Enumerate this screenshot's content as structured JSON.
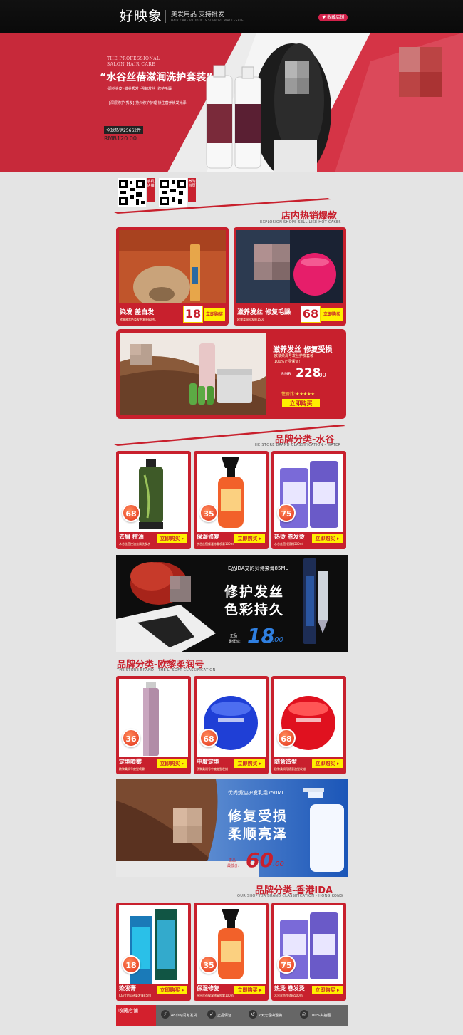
{
  "header": {
    "logo": "好映象",
    "slogan": "美发用品 支持批发",
    "slogan_sub": "HAIR CARE PRODUCTS SUPPORT WHOLESALE",
    "favorite": "收藏店铺"
  },
  "hero": {
    "eng1": "THE PROFESSIONAL",
    "eng2": "SALON HAIR CARE",
    "eng3": "",
    "title": "“水谷丝蓓滋润洗护套装”",
    "features": "·调养头皮 ·滋养秀发 ·强韧发丝 ·修护毛躁",
    "desc": "[深层修护·秀发] 持久修护护理·锁住营养焕发光泽",
    "sales": "全球热销25662件",
    "price": "RMB120.00"
  },
  "qr": {
    "tag1": "手机店铺",
    "tag2": "微淘首页"
  },
  "sections": {
    "hot": {
      "title": "店内热销爆款",
      "sub": "EXPLOSION SHOPS SELL LIKE HOT CAKES"
    },
    "water": {
      "title": "品牌分类-水谷",
      "sub": "HE STORE BRAND CLASSIFICATION - WATER"
    },
    "li": {
      "title": "品牌分类-欧黎柔润号",
      "sub": "THE STORE BRAND - THE LI SOFT CLASSIFICATION"
    },
    "ida": {
      "title": "品牌分类-香港IDA",
      "sub": "OUR SHOP IDA BRAND CLASSIFICATION - HONG KONG"
    }
  },
  "hot_cards": [
    {
      "title": "染发 盖白发",
      "sub": "欧莱雅黑色染发剂套装80ML",
      "price": "18",
      "buy": "立即购买"
    },
    {
      "title": "滋养发丝 修复毛躁",
      "sub": "欧黎柔润号发膜150g",
      "price": "68",
      "buy": "立即购买"
    }
  ],
  "big_card": {
    "title": "滋养发丝 修复受损",
    "sub1": "欧黎柔润号发丝护发套装",
    "sub2": "100%正品保证!",
    "price": "228",
    "price_dec": ".00",
    "rmb": "RMB",
    "rating": "性价比:★★★★★",
    "buy": "立即购买"
  },
  "water_cards": [
    {
      "badge": "68",
      "title": "去屑 控油",
      "sub": "水谷丝蓓控油去屑洗发水",
      "buy": "立即购买"
    },
    {
      "badge": "35",
      "title": "保湿修复",
      "sub": "水谷丝蓓保湿修复喷雾100ml",
      "buy": "立即购买"
    },
    {
      "badge": "75",
      "title": "热烫 卷发烫",
      "sub": "水谷丝蓓冷烫精500ml",
      "buy": "立即购买"
    }
  ],
  "banner1": {
    "small": "E品IDA艾的贝诗染膏85ML",
    "line1": "修护发丝",
    "line2": "色彩持久",
    "label1": "正品",
    "label2": "最低价:",
    "price": "18",
    "dec": ".00"
  },
  "li_cards": [
    {
      "badge": "36",
      "title": "定型喷雾",
      "sub": "欧黎柔润号定型喷雾",
      "buy": "立即购买"
    },
    {
      "badge": "68",
      "title": "中度定型",
      "sub": "欧黎柔润号中度定型发蜡",
      "buy": "立即购买"
    },
    {
      "badge": "68",
      "title": "随意造型",
      "sub": "欧黎柔润号随意造型发蜡",
      "buy": "立即购买"
    }
  ],
  "banner2": {
    "small": "优尚焗油护发乳霜750ML",
    "line1": "修复受损",
    "line2": "柔顺亮泽",
    "label1": "正品",
    "label2": "最低价:",
    "price": "60",
    "dec": ".00"
  },
  "ida_cards": [
    {
      "badge": "18",
      "title": "染发膏",
      "sub": "IDA艾的贝诗染发膏85ml",
      "buy": "立即购买"
    },
    {
      "badge": "35",
      "title": "保湿修复",
      "sub": "水谷丝蓓保湿修复喷雾100ml",
      "buy": "立即购买"
    },
    {
      "badge": "75",
      "title": "热烫 卷发烫",
      "sub": "水谷丝蓓冷烫精500ml",
      "buy": "立即购买"
    }
  ],
  "footer": {
    "brand": "收藏店铺",
    "items": [
      "48小时闪电发货",
      "正品保证",
      "7天无理由退换",
      "100%实拍图"
    ]
  },
  "colors": {
    "brand_red": "#c8202d",
    "yellow": "#fff000",
    "header": "#0a0a0a"
  }
}
